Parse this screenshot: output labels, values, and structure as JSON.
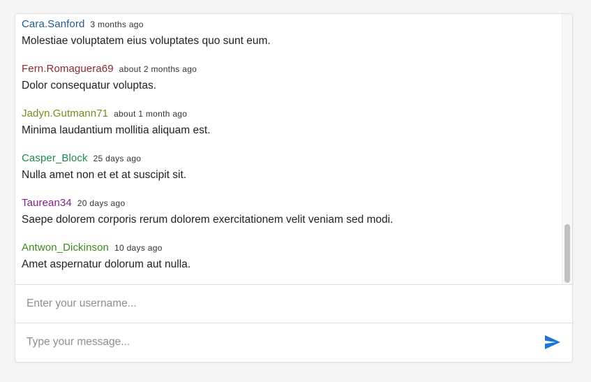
{
  "messages": [
    {
      "username": "Cara.Sanford",
      "time": "3 months ago",
      "text": "Molestiae voluptatem eius voluptates quo sunt eum.",
      "color": "#1f5a91"
    },
    {
      "username": "Fern.Romaguera69",
      "time": "about 2 months ago",
      "text": "Dolor consequatur voluptas.",
      "color": "#8c2a2a"
    },
    {
      "username": "Jadyn.Gutmann71",
      "time": "about 1 month ago",
      "text": "Minima laudantium mollitia aliquam est.",
      "color": "#7a8a1e"
    },
    {
      "username": "Casper_Block",
      "time": "25 days ago",
      "text": "Nulla amet non et et at suscipit sit.",
      "color": "#1e8a4a"
    },
    {
      "username": "Taurean34",
      "time": "20 days ago",
      "text": "Saepe dolorem corporis rerum dolorem exercitationem velit veniam sed modi.",
      "color": "#8a1e8a"
    },
    {
      "username": "Antwon_Dickinson",
      "time": "10 days ago",
      "text": "Amet aspernatur dolorum aut nulla.",
      "color": "#3a8a1e"
    }
  ],
  "username_field": {
    "placeholder": "Enter your username...",
    "value": ""
  },
  "message_field": {
    "placeholder": "Type your message...",
    "value": ""
  },
  "send": {
    "icon": "send-icon",
    "color": "#1976d2"
  },
  "scroll": {
    "position_fraction": 1.0,
    "visible_fraction": 0.22
  }
}
